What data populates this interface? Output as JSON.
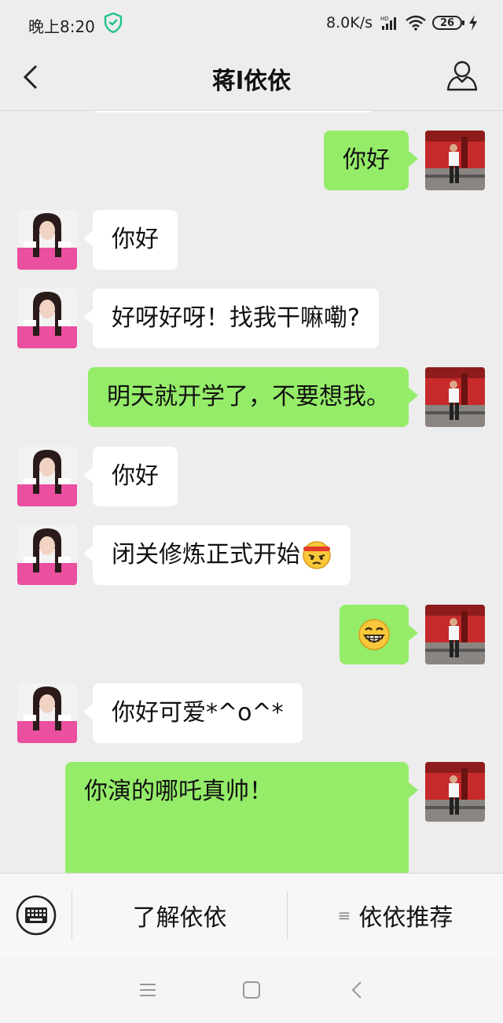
{
  "status_bar": {
    "time": "晚上8:20",
    "network_speed": "8.0K/s",
    "battery_level": "26",
    "icons": [
      "shield-icon",
      "hd-signal-icon",
      "wifi-icon",
      "battery-icon",
      "charging-icon"
    ]
  },
  "header": {
    "title": "蒋l依依",
    "back_icon": "chevron-left-icon",
    "profile_icon": "person-icon"
  },
  "chat": {
    "messages": [
      {
        "sender": "me",
        "text": "你好"
      },
      {
        "sender": "contact",
        "text": "你好"
      },
      {
        "sender": "contact",
        "text": "好呀好呀！找我干嘛嘞?"
      },
      {
        "sender": "me",
        "text": "明天就开学了，不要想我。"
      },
      {
        "sender": "contact",
        "text": "你好"
      },
      {
        "sender": "contact",
        "text": "闭关修炼正式开始",
        "emoji": "determined-face-emoji"
      },
      {
        "sender": "me",
        "text": "",
        "emoji": "grinning-face-emoji"
      },
      {
        "sender": "contact",
        "text": "你好可爱*^o^*"
      },
      {
        "sender": "me",
        "text": "你演的哪吒真帅！"
      }
    ]
  },
  "menu": {
    "keyboard_icon": "keyboard-icon",
    "item1": "了解依依",
    "item2_icon": "≡",
    "item2": "依依推荐"
  },
  "nav_bar": {
    "icons": [
      "menu-icon",
      "home-icon",
      "back-icon"
    ]
  },
  "colors": {
    "background": "#ededed",
    "bubble_out": "#95ec69",
    "bubble_in": "#ffffff"
  }
}
